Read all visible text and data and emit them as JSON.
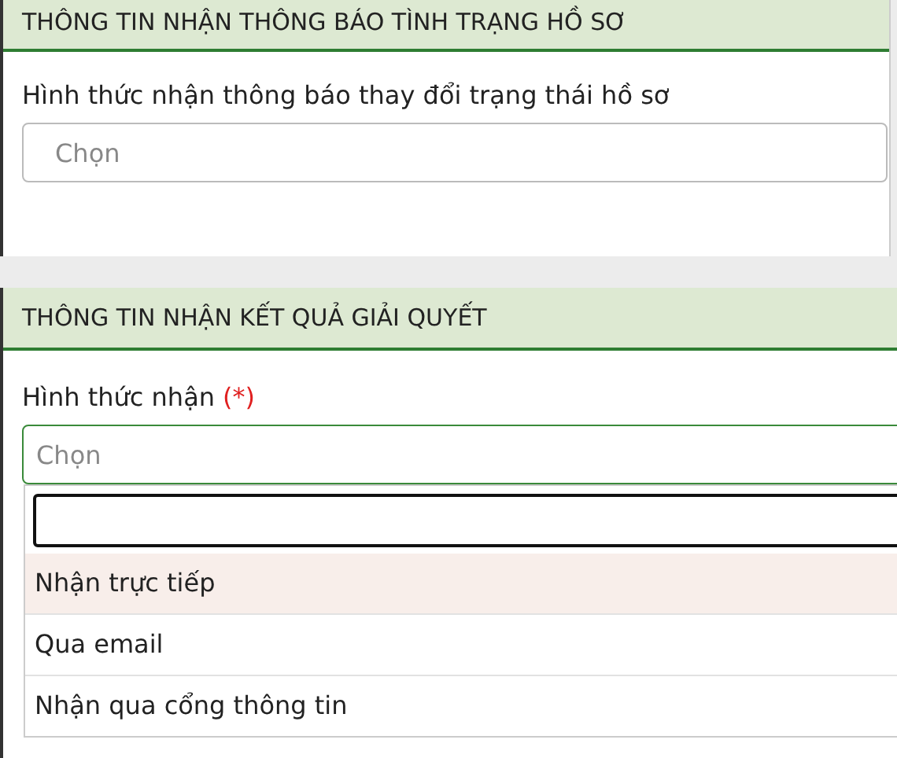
{
  "sections": [
    {
      "title": "THÔNG TIN NHẬN THÔNG BÁO TÌNH TRẠNG HỒ SƠ",
      "field": {
        "label": "Hình thức nhận thông báo thay đổi trạng thái hồ sơ",
        "placeholder": "Chọn",
        "focused": false
      }
    },
    {
      "title": "THÔNG TIN NHẬN KẾT QUẢ GIẢI QUYẾT",
      "field": {
        "label": "Hình thức nhận",
        "required_mark": "(*)",
        "placeholder": "Chọn",
        "focused": true
      },
      "dropdown": {
        "options": [
          {
            "label": "Nhận trực tiếp",
            "selected": true
          },
          {
            "label": "Qua email",
            "selected": false
          },
          {
            "label": "Nhận qua cổng thông tin",
            "selected": false
          }
        ]
      }
    }
  ]
}
